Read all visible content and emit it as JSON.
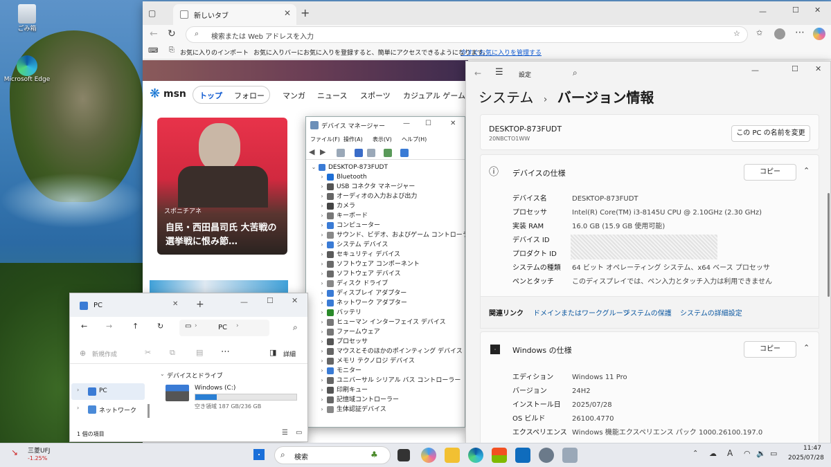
{
  "desktop": {
    "recycle_label": "ごみ箱",
    "edge_label": "Microsoft Edge"
  },
  "browser": {
    "tab_title": "新しいタブ",
    "address_placeholder": "検索または Web アドレスを入力",
    "fav_import": "お気に入りのインポート",
    "fav_message": "お気に入りバーにお気に入りを登録すると、簡単にアクセスできるようになります。",
    "fav_manage": "今すぐお気に入りを管理する",
    "msn": {
      "logo": "msn",
      "tabs": [
        "トップ",
        "フォロー",
        "マンガ",
        "ニュース",
        "スポーツ",
        "カジュアル ゲーム"
      ],
      "source": "スポニチアネ",
      "headline": "自民・西田昌司氏 大苦戦の選挙戦に恨み節…"
    }
  },
  "devmgr": {
    "title": "デバイス マネージャー",
    "menu": [
      "ファイル(F)",
      "操作(A)",
      "表示(V)",
      "ヘルプ(H)"
    ],
    "root": "DESKTOP-873FUDT",
    "items": [
      "Bluetooth",
      "USB コネクタ マネージャー",
      "オーディオの入力および出力",
      "カメラ",
      "キーボード",
      "コンピューター",
      "サウンド、ビデオ、およびゲーム コントローラー",
      "システム デバイス",
      "セキュリティ デバイス",
      "ソフトウェア コンポーネント",
      "ソフトウェア デバイス",
      "ディスク ドライブ",
      "ディスプレイ アダプター",
      "ネットワーク アダプター",
      "バッテリ",
      "ヒューマン インターフェイス デバイス",
      "ファームウェア",
      "プロセッサ",
      "マウスとそのほかのポインティング デバイス",
      "メモリ テクノロジ デバイス",
      "モニター",
      "ユニバーサル シリアル バス コントローラー",
      "印刷キュー",
      "記憶域コントローラー",
      "生体認証デバイス"
    ],
    "item_colors": [
      "#1e6fd6",
      "#555",
      "#666",
      "#444",
      "#777",
      "#3a7bd5",
      "#888",
      "#3a7bd5",
      "#5a5a5a",
      "#6a6a6a",
      "#6a6a6a",
      "#888",
      "#3a7bd5",
      "#3a7bd5",
      "#2a8a2a",
      "#777",
      "#777",
      "#555",
      "#666",
      "#666",
      "#3a7bd5",
      "#666",
      "#555",
      "#666",
      "#888"
    ]
  },
  "settings": {
    "label": "設定",
    "crumb_parent": "システム",
    "crumb_sep": "›",
    "crumb_current": "バージョン情報",
    "pc_name": "DESKTOP-873FUDT",
    "pc_model": "20NBCTO1WW",
    "rename_btn": "この PC の名前を変更",
    "device_section": "デバイスの仕様",
    "copy": "コピー",
    "device_specs": [
      {
        "k": "デバイス名",
        "v": "DESKTOP-873FUDT"
      },
      {
        "k": "プロセッサ",
        "v": "Intel(R) Core(TM) i3-8145U CPU @ 2.10GHz (2.30 GHz)"
      },
      {
        "k": "実装 RAM",
        "v": "16.0 GB (15.9 GB 使用可能)"
      },
      {
        "k": "デバイス ID",
        "v": ""
      },
      {
        "k": "プロダクト ID",
        "v": ""
      },
      {
        "k": "システムの種類",
        "v": "64 ビット オペレーティング システム、x64 ベース プロセッサ"
      },
      {
        "k": "ペンとタッチ",
        "v": "このディスプレイでは、ペン入力とタッチ入力は利用できません"
      }
    ],
    "related_label": "関連リンク",
    "related_links": [
      "ドメインまたはワークグループ",
      "システムの保護",
      "システムの詳細設定"
    ],
    "windows_section": "Windows の仕様",
    "windows_specs": [
      {
        "k": "エディション",
        "v": "Windows 11 Pro"
      },
      {
        "k": "バージョン",
        "v": "24H2"
      },
      {
        "k": "インストール日",
        "v": "2025/07/28"
      },
      {
        "k": "OS ビルド",
        "v": "26100.4770"
      },
      {
        "k": "エクスペリエンス",
        "v": "Windows 機能エクスペリエンス パック 1000.26100.197.0"
      }
    ]
  },
  "explorer": {
    "title": "PC",
    "path": "PC",
    "new_btn": "新規作成",
    "details_btn": "詳細",
    "nav": [
      "PC",
      "ネットワーク"
    ],
    "group": "デバイスとドライブ",
    "drive_name": "Windows (C:)",
    "drive_free": "空き領域 187 GB/236 GB",
    "drive_used_fraction": 0.21,
    "status": "1 個の項目"
  },
  "taskbar": {
    "stock_name": "三菱UFJ",
    "stock_change": "-1.25%",
    "search": "検索",
    "ime": "A",
    "time": "11:47",
    "date": "2025/07/28"
  }
}
